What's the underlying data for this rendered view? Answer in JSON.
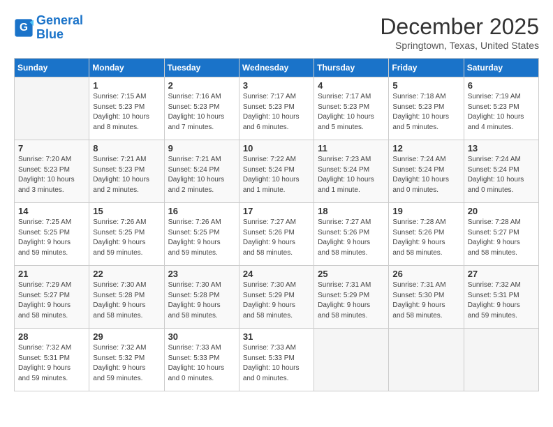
{
  "header": {
    "logo_line1": "General",
    "logo_line2": "Blue",
    "month": "December 2025",
    "location": "Springtown, Texas, United States"
  },
  "days_of_week": [
    "Sunday",
    "Monday",
    "Tuesday",
    "Wednesday",
    "Thursday",
    "Friday",
    "Saturday"
  ],
  "weeks": [
    [
      {
        "day": "",
        "info": ""
      },
      {
        "day": "1",
        "info": "Sunrise: 7:15 AM\nSunset: 5:23 PM\nDaylight: 10 hours\nand 8 minutes."
      },
      {
        "day": "2",
        "info": "Sunrise: 7:16 AM\nSunset: 5:23 PM\nDaylight: 10 hours\nand 7 minutes."
      },
      {
        "day": "3",
        "info": "Sunrise: 7:17 AM\nSunset: 5:23 PM\nDaylight: 10 hours\nand 6 minutes."
      },
      {
        "day": "4",
        "info": "Sunrise: 7:17 AM\nSunset: 5:23 PM\nDaylight: 10 hours\nand 5 minutes."
      },
      {
        "day": "5",
        "info": "Sunrise: 7:18 AM\nSunset: 5:23 PM\nDaylight: 10 hours\nand 5 minutes."
      },
      {
        "day": "6",
        "info": "Sunrise: 7:19 AM\nSunset: 5:23 PM\nDaylight: 10 hours\nand 4 minutes."
      }
    ],
    [
      {
        "day": "7",
        "info": "Sunrise: 7:20 AM\nSunset: 5:23 PM\nDaylight: 10 hours\nand 3 minutes."
      },
      {
        "day": "8",
        "info": "Sunrise: 7:21 AM\nSunset: 5:23 PM\nDaylight: 10 hours\nand 2 minutes."
      },
      {
        "day": "9",
        "info": "Sunrise: 7:21 AM\nSunset: 5:24 PM\nDaylight: 10 hours\nand 2 minutes."
      },
      {
        "day": "10",
        "info": "Sunrise: 7:22 AM\nSunset: 5:24 PM\nDaylight: 10 hours\nand 1 minute."
      },
      {
        "day": "11",
        "info": "Sunrise: 7:23 AM\nSunset: 5:24 PM\nDaylight: 10 hours\nand 1 minute."
      },
      {
        "day": "12",
        "info": "Sunrise: 7:24 AM\nSunset: 5:24 PM\nDaylight: 10 hours\nand 0 minutes."
      },
      {
        "day": "13",
        "info": "Sunrise: 7:24 AM\nSunset: 5:24 PM\nDaylight: 10 hours\nand 0 minutes."
      }
    ],
    [
      {
        "day": "14",
        "info": "Sunrise: 7:25 AM\nSunset: 5:25 PM\nDaylight: 9 hours\nand 59 minutes."
      },
      {
        "day": "15",
        "info": "Sunrise: 7:26 AM\nSunset: 5:25 PM\nDaylight: 9 hours\nand 59 minutes."
      },
      {
        "day": "16",
        "info": "Sunrise: 7:26 AM\nSunset: 5:25 PM\nDaylight: 9 hours\nand 59 minutes."
      },
      {
        "day": "17",
        "info": "Sunrise: 7:27 AM\nSunset: 5:26 PM\nDaylight: 9 hours\nand 58 minutes."
      },
      {
        "day": "18",
        "info": "Sunrise: 7:27 AM\nSunset: 5:26 PM\nDaylight: 9 hours\nand 58 minutes."
      },
      {
        "day": "19",
        "info": "Sunrise: 7:28 AM\nSunset: 5:26 PM\nDaylight: 9 hours\nand 58 minutes."
      },
      {
        "day": "20",
        "info": "Sunrise: 7:28 AM\nSunset: 5:27 PM\nDaylight: 9 hours\nand 58 minutes."
      }
    ],
    [
      {
        "day": "21",
        "info": "Sunrise: 7:29 AM\nSunset: 5:27 PM\nDaylight: 9 hours\nand 58 minutes."
      },
      {
        "day": "22",
        "info": "Sunrise: 7:30 AM\nSunset: 5:28 PM\nDaylight: 9 hours\nand 58 minutes."
      },
      {
        "day": "23",
        "info": "Sunrise: 7:30 AM\nSunset: 5:28 PM\nDaylight: 9 hours\nand 58 minutes."
      },
      {
        "day": "24",
        "info": "Sunrise: 7:30 AM\nSunset: 5:29 PM\nDaylight: 9 hours\nand 58 minutes."
      },
      {
        "day": "25",
        "info": "Sunrise: 7:31 AM\nSunset: 5:29 PM\nDaylight: 9 hours\nand 58 minutes."
      },
      {
        "day": "26",
        "info": "Sunrise: 7:31 AM\nSunset: 5:30 PM\nDaylight: 9 hours\nand 58 minutes."
      },
      {
        "day": "27",
        "info": "Sunrise: 7:32 AM\nSunset: 5:31 PM\nDaylight: 9 hours\nand 59 minutes."
      }
    ],
    [
      {
        "day": "28",
        "info": "Sunrise: 7:32 AM\nSunset: 5:31 PM\nDaylight: 9 hours\nand 59 minutes."
      },
      {
        "day": "29",
        "info": "Sunrise: 7:32 AM\nSunset: 5:32 PM\nDaylight: 9 hours\nand 59 minutes."
      },
      {
        "day": "30",
        "info": "Sunrise: 7:33 AM\nSunset: 5:33 PM\nDaylight: 10 hours\nand 0 minutes."
      },
      {
        "day": "31",
        "info": "Sunrise: 7:33 AM\nSunset: 5:33 PM\nDaylight: 10 hours\nand 0 minutes."
      },
      {
        "day": "",
        "info": ""
      },
      {
        "day": "",
        "info": ""
      },
      {
        "day": "",
        "info": ""
      }
    ]
  ]
}
